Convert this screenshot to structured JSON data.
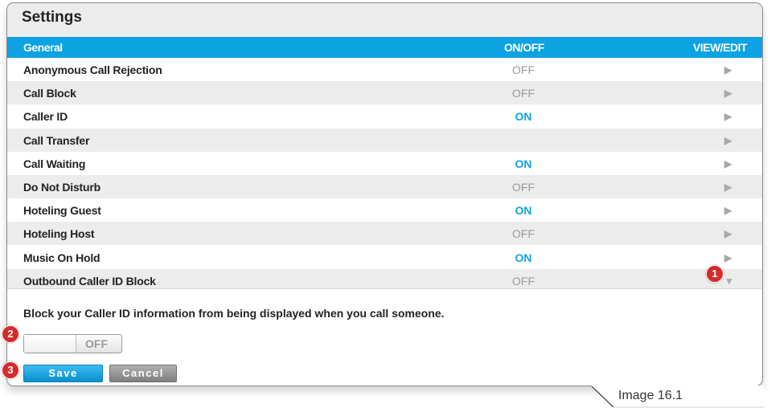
{
  "panel": {
    "title": "Settings"
  },
  "header": {
    "general": "General",
    "on_off": "ON/OFF",
    "view_edit": "VIEW/EDIT"
  },
  "rows": [
    {
      "label": "Anonymous Call Rejection",
      "state": "OFF"
    },
    {
      "label": "Call Block",
      "state": "OFF"
    },
    {
      "label": "Caller ID",
      "state": "ON"
    },
    {
      "label": "Call Transfer",
      "state": ""
    },
    {
      "label": "Call Waiting",
      "state": "ON"
    },
    {
      "label": "Do Not Disturb",
      "state": "OFF"
    },
    {
      "label": "Hoteling Guest",
      "state": "ON"
    },
    {
      "label": "Hoteling Host",
      "state": "OFF"
    },
    {
      "label": "Music On Hold",
      "state": "ON"
    },
    {
      "label": "Outbound Caller ID Block",
      "state": "OFF"
    }
  ],
  "icons": {
    "collapsed": "play-arrow-icon",
    "expanded": "caret-down-icon"
  },
  "detail": {
    "description": "Block your Caller ID information from being displayed when you call someone.",
    "toggle_label": "OFF",
    "save_label": "Save",
    "cancel_label": "Cancel"
  },
  "badges": [
    "1",
    "2",
    "3"
  ],
  "caption": "Image 16.1",
  "colors": {
    "accent": "#0da3e2",
    "on": "#0da3e2",
    "off": "#9b9b9b",
    "badge": "#d52b2b"
  }
}
